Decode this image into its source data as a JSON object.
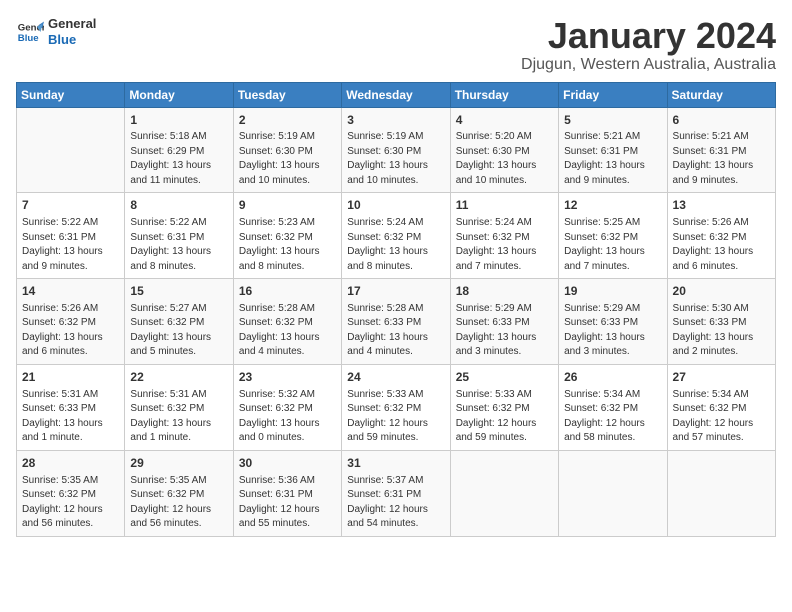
{
  "logo": {
    "line1": "General",
    "line2": "Blue"
  },
  "title": "January 2024",
  "subtitle": "Djugun, Western Australia, Australia",
  "days_header": [
    "Sunday",
    "Monday",
    "Tuesday",
    "Wednesday",
    "Thursday",
    "Friday",
    "Saturday"
  ],
  "weeks": [
    [
      {
        "num": "",
        "info": ""
      },
      {
        "num": "1",
        "info": "Sunrise: 5:18 AM\nSunset: 6:29 PM\nDaylight: 13 hours\nand 11 minutes."
      },
      {
        "num": "2",
        "info": "Sunrise: 5:19 AM\nSunset: 6:30 PM\nDaylight: 13 hours\nand 10 minutes."
      },
      {
        "num": "3",
        "info": "Sunrise: 5:19 AM\nSunset: 6:30 PM\nDaylight: 13 hours\nand 10 minutes."
      },
      {
        "num": "4",
        "info": "Sunrise: 5:20 AM\nSunset: 6:30 PM\nDaylight: 13 hours\nand 10 minutes."
      },
      {
        "num": "5",
        "info": "Sunrise: 5:21 AM\nSunset: 6:31 PM\nDaylight: 13 hours\nand 9 minutes."
      },
      {
        "num": "6",
        "info": "Sunrise: 5:21 AM\nSunset: 6:31 PM\nDaylight: 13 hours\nand 9 minutes."
      }
    ],
    [
      {
        "num": "7",
        "info": "Sunrise: 5:22 AM\nSunset: 6:31 PM\nDaylight: 13 hours\nand 9 minutes."
      },
      {
        "num": "8",
        "info": "Sunrise: 5:22 AM\nSunset: 6:31 PM\nDaylight: 13 hours\nand 8 minutes."
      },
      {
        "num": "9",
        "info": "Sunrise: 5:23 AM\nSunset: 6:32 PM\nDaylight: 13 hours\nand 8 minutes."
      },
      {
        "num": "10",
        "info": "Sunrise: 5:24 AM\nSunset: 6:32 PM\nDaylight: 13 hours\nand 8 minutes."
      },
      {
        "num": "11",
        "info": "Sunrise: 5:24 AM\nSunset: 6:32 PM\nDaylight: 13 hours\nand 7 minutes."
      },
      {
        "num": "12",
        "info": "Sunrise: 5:25 AM\nSunset: 6:32 PM\nDaylight: 13 hours\nand 7 minutes."
      },
      {
        "num": "13",
        "info": "Sunrise: 5:26 AM\nSunset: 6:32 PM\nDaylight: 13 hours\nand 6 minutes."
      }
    ],
    [
      {
        "num": "14",
        "info": "Sunrise: 5:26 AM\nSunset: 6:32 PM\nDaylight: 13 hours\nand 6 minutes."
      },
      {
        "num": "15",
        "info": "Sunrise: 5:27 AM\nSunset: 6:32 PM\nDaylight: 13 hours\nand 5 minutes."
      },
      {
        "num": "16",
        "info": "Sunrise: 5:28 AM\nSunset: 6:32 PM\nDaylight: 13 hours\nand 4 minutes."
      },
      {
        "num": "17",
        "info": "Sunrise: 5:28 AM\nSunset: 6:33 PM\nDaylight: 13 hours\nand 4 minutes."
      },
      {
        "num": "18",
        "info": "Sunrise: 5:29 AM\nSunset: 6:33 PM\nDaylight: 13 hours\nand 3 minutes."
      },
      {
        "num": "19",
        "info": "Sunrise: 5:29 AM\nSunset: 6:33 PM\nDaylight: 13 hours\nand 3 minutes."
      },
      {
        "num": "20",
        "info": "Sunrise: 5:30 AM\nSunset: 6:33 PM\nDaylight: 13 hours\nand 2 minutes."
      }
    ],
    [
      {
        "num": "21",
        "info": "Sunrise: 5:31 AM\nSunset: 6:33 PM\nDaylight: 13 hours\nand 1 minute."
      },
      {
        "num": "22",
        "info": "Sunrise: 5:31 AM\nSunset: 6:32 PM\nDaylight: 13 hours\nand 1 minute."
      },
      {
        "num": "23",
        "info": "Sunrise: 5:32 AM\nSunset: 6:32 PM\nDaylight: 13 hours\nand 0 minutes."
      },
      {
        "num": "24",
        "info": "Sunrise: 5:33 AM\nSunset: 6:32 PM\nDaylight: 12 hours\nand 59 minutes."
      },
      {
        "num": "25",
        "info": "Sunrise: 5:33 AM\nSunset: 6:32 PM\nDaylight: 12 hours\nand 59 minutes."
      },
      {
        "num": "26",
        "info": "Sunrise: 5:34 AM\nSunset: 6:32 PM\nDaylight: 12 hours\nand 58 minutes."
      },
      {
        "num": "27",
        "info": "Sunrise: 5:34 AM\nSunset: 6:32 PM\nDaylight: 12 hours\nand 57 minutes."
      }
    ],
    [
      {
        "num": "28",
        "info": "Sunrise: 5:35 AM\nSunset: 6:32 PM\nDaylight: 12 hours\nand 56 minutes."
      },
      {
        "num": "29",
        "info": "Sunrise: 5:35 AM\nSunset: 6:32 PM\nDaylight: 12 hours\nand 56 minutes."
      },
      {
        "num": "30",
        "info": "Sunrise: 5:36 AM\nSunset: 6:31 PM\nDaylight: 12 hours\nand 55 minutes."
      },
      {
        "num": "31",
        "info": "Sunrise: 5:37 AM\nSunset: 6:31 PM\nDaylight: 12 hours\nand 54 minutes."
      },
      {
        "num": "",
        "info": ""
      },
      {
        "num": "",
        "info": ""
      },
      {
        "num": "",
        "info": ""
      }
    ]
  ]
}
